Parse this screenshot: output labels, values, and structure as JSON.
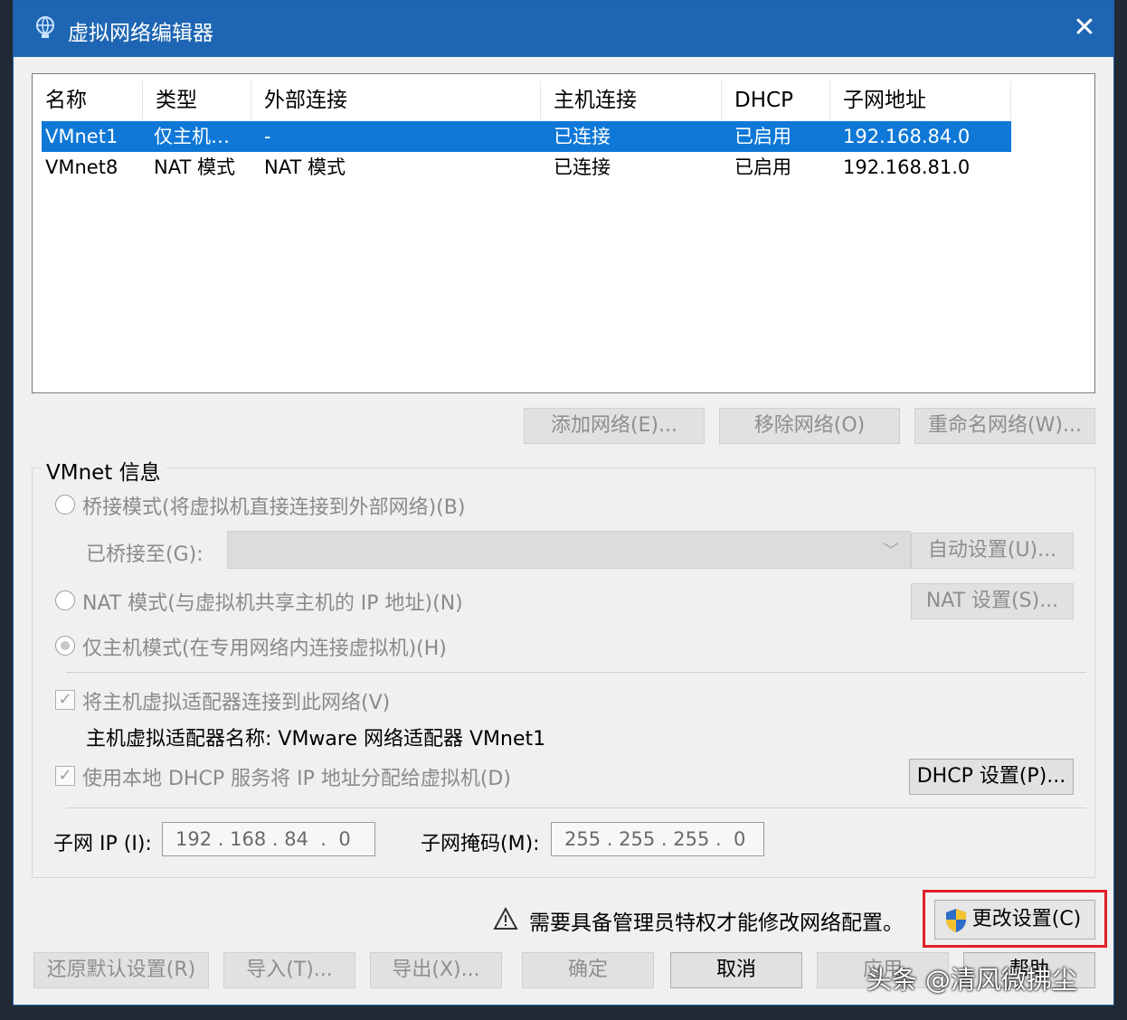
{
  "window": {
    "title": "虚拟网络编辑器",
    "close_glyph": "✕"
  },
  "table": {
    "headers": [
      "名称",
      "类型",
      "外部连接",
      "主机连接",
      "DHCP",
      "子网地址"
    ],
    "rows": [
      {
        "name": "VMnet1",
        "type": "仅主机…",
        "external": "-",
        "host": "已连接",
        "dhcp": "已启用",
        "subnet": "192.168.84.0",
        "selected": true
      },
      {
        "name": "VMnet8",
        "type": "NAT 模式",
        "external": "NAT 模式",
        "host": "已连接",
        "dhcp": "已启用",
        "subnet": "192.168.81.0",
        "selected": false
      }
    ]
  },
  "net_buttons": {
    "add": "添加网络(E)...",
    "remove": "移除网络(O)",
    "rename": "重命名网络(W)..."
  },
  "vmnet_info": {
    "title": "VMnet 信息",
    "bridged": "桥接模式(将虚拟机直接连接到外部网络)(B)",
    "bridged_to_label": "已桥接至(G):",
    "auto_settings": "自动设置(U)...",
    "nat": "NAT 模式(与虚拟机共享主机的 IP 地址)(N)",
    "nat_settings": "NAT 设置(S)...",
    "host_only": "仅主机模式(在专用网络内连接虚拟机)(H)",
    "connect_adapter": "将主机虚拟适配器连接到此网络(V)",
    "adapter_name": "主机虚拟适配器名称: VMware 网络适配器 VMnet1",
    "use_dhcp": "使用本地 DHCP 服务将 IP 地址分配给虚拟机(D)",
    "dhcp_settings": "DHCP 设置(P)...",
    "subnet_ip_label": "子网 IP (I):",
    "subnet_ip": "192 . 168 . 84  .  0",
    "subnet_mask_label": "子网掩码(M):",
    "subnet_mask": "255 . 255 . 255 .  0"
  },
  "admin": {
    "warning": "需要具备管理员特权才能修改网络配置。",
    "change_settings": "更改设置(C)"
  },
  "footer": {
    "restore": "还原默认设置(R)",
    "import": "导入(T)...",
    "export": "导出(X)...",
    "ok": "确定",
    "cancel": "取消",
    "apply": "应用",
    "help": "帮助"
  },
  "watermark": "头条 @清风微拂尘",
  "colors": {
    "titlebar": "#1e66b3",
    "selection": "#0f78d7",
    "highlight": "#e0202a"
  }
}
